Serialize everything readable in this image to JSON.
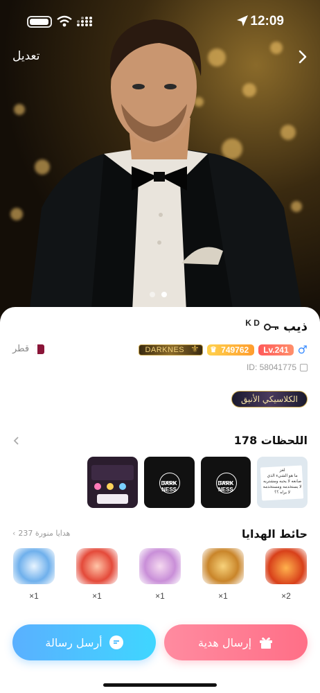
{
  "status": {
    "time": "12:09"
  },
  "topbar": {
    "edit_label": "تعديل"
  },
  "hero": {
    "carousel_active": 1,
    "carousel_total": 2
  },
  "profile": {
    "name": "ذيب",
    "name_deco": "K D",
    "gender_symbol": "♂",
    "level": "Lv.241",
    "wealth": "749762",
    "family": "DARKNES",
    "country": "قطر",
    "id": "ID: 58041775",
    "medal": "الكلاسيكي الأنيق"
  },
  "moments": {
    "title": "اللحظات 178",
    "items": [
      {
        "kind": "note",
        "caption": "لغز\nما هو الشيء الذي\nصانعه لا يحبه ومشتريه\nلا يستخدمه ومستخدمه\nلا يراه ؟؟"
      },
      {
        "kind": "dark",
        "caption": "DARK NESS"
      },
      {
        "kind": "dark",
        "caption": "DARK NESS"
      },
      {
        "kind": "app",
        "caption": ""
      }
    ]
  },
  "gifts": {
    "title": "حائط الهدايا",
    "lit_count": "237 هدايا منورة",
    "items": [
      {
        "qty": "2×",
        "icon": "lion-gift-icon",
        "color": "#ff7a2e"
      },
      {
        "qty": "1×",
        "icon": "golden-man-gift-icon",
        "color": "#ffcc66"
      },
      {
        "qty": "1×",
        "icon": "fairy-gift-icon",
        "color": "#e6b9f0"
      },
      {
        "qty": "1×",
        "icon": "kite-gift-icon",
        "color": "#ff5a5a"
      },
      {
        "qty": "1×",
        "icon": "yacht-gift-icon",
        "color": "#7fc3ff"
      }
    ]
  },
  "actions": {
    "send_gift": "إرسال هدية",
    "send_message": "أرسل رسالة"
  },
  "colors": {
    "level_badge": "#ff6b6b",
    "wealth_badge": "#ffb23d",
    "gift_button": "#ff7890",
    "message_button": "#4ec4ff"
  }
}
